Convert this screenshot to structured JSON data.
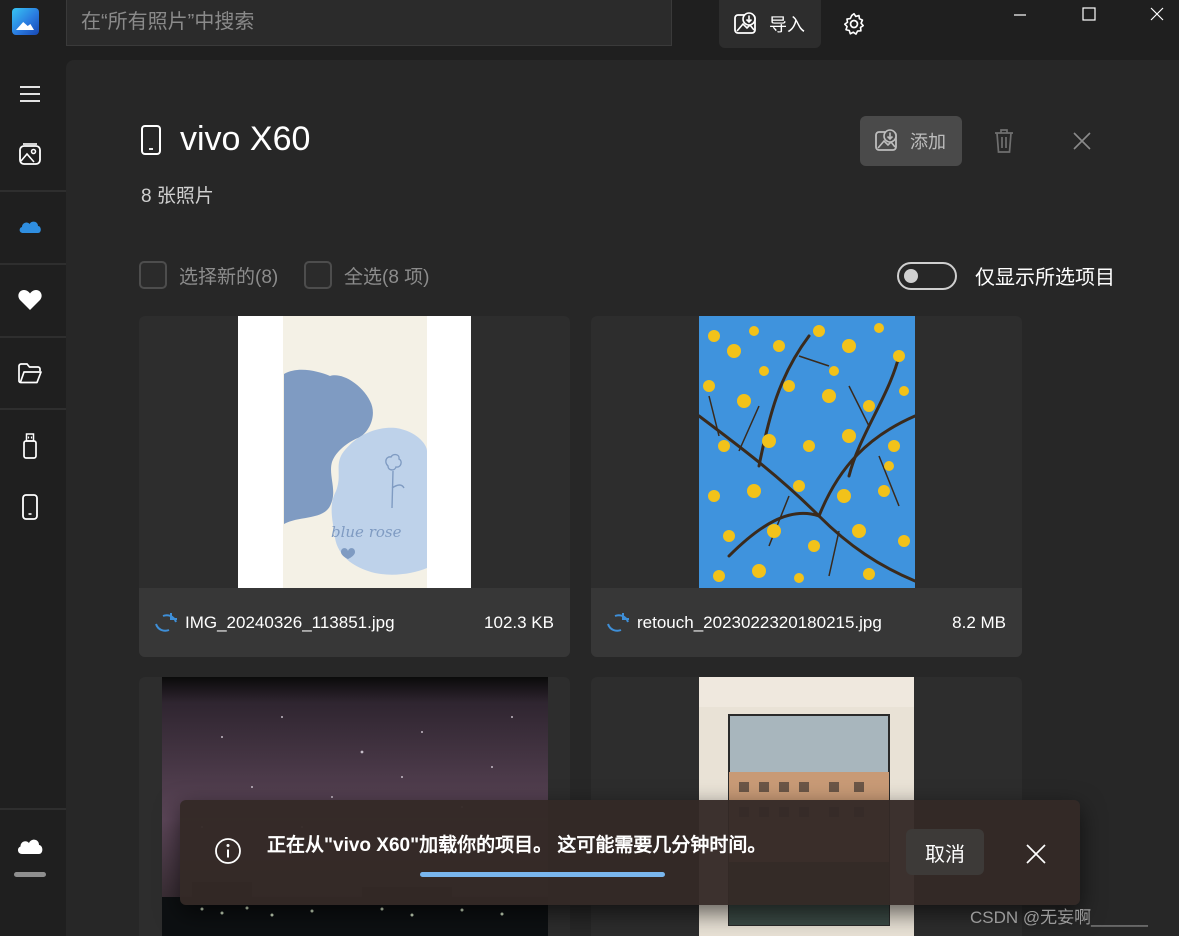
{
  "titlebar": {
    "search_placeholder": "在“所有照片”中搜索",
    "import_label": "导入",
    "settings_icon": "gear-icon",
    "window_controls": [
      "minimize-icon",
      "maximize-icon",
      "close-icon"
    ]
  },
  "sidebar": {
    "items": [
      "menu-icon",
      "gallery-icon",
      "onedrive-icon",
      "favorites-icon",
      "folder-icon",
      "usb-drive-icon",
      "phone-icon",
      "icloud-icon"
    ]
  },
  "device": {
    "name": "vivo X60",
    "photo_count": "8 张照片",
    "add_label": "添加",
    "select_new": "选择新的(8)",
    "select_all": "全选(8 项)",
    "show_selected_only": "仅显示所选项目",
    "show_selected_on": false
  },
  "photos": [
    {
      "filename": "IMG_20240326_113851.jpg",
      "size": "102.3 KB"
    },
    {
      "filename": "retouch_2023022320180215.jpg",
      "size": "8.2 MB"
    }
  ],
  "photo_art": {
    "blue_rose_text": "blue rose"
  },
  "toast": {
    "message": "正在从\"vivo X60\"加载你的项目。 这可能需要几分钟时间。",
    "cancel_label": "取消"
  },
  "watermark": "CSDN @无妄啊______",
  "colors": {
    "accent": "#79b6ee",
    "background": "#1f1f1f",
    "panel": "#272727"
  }
}
